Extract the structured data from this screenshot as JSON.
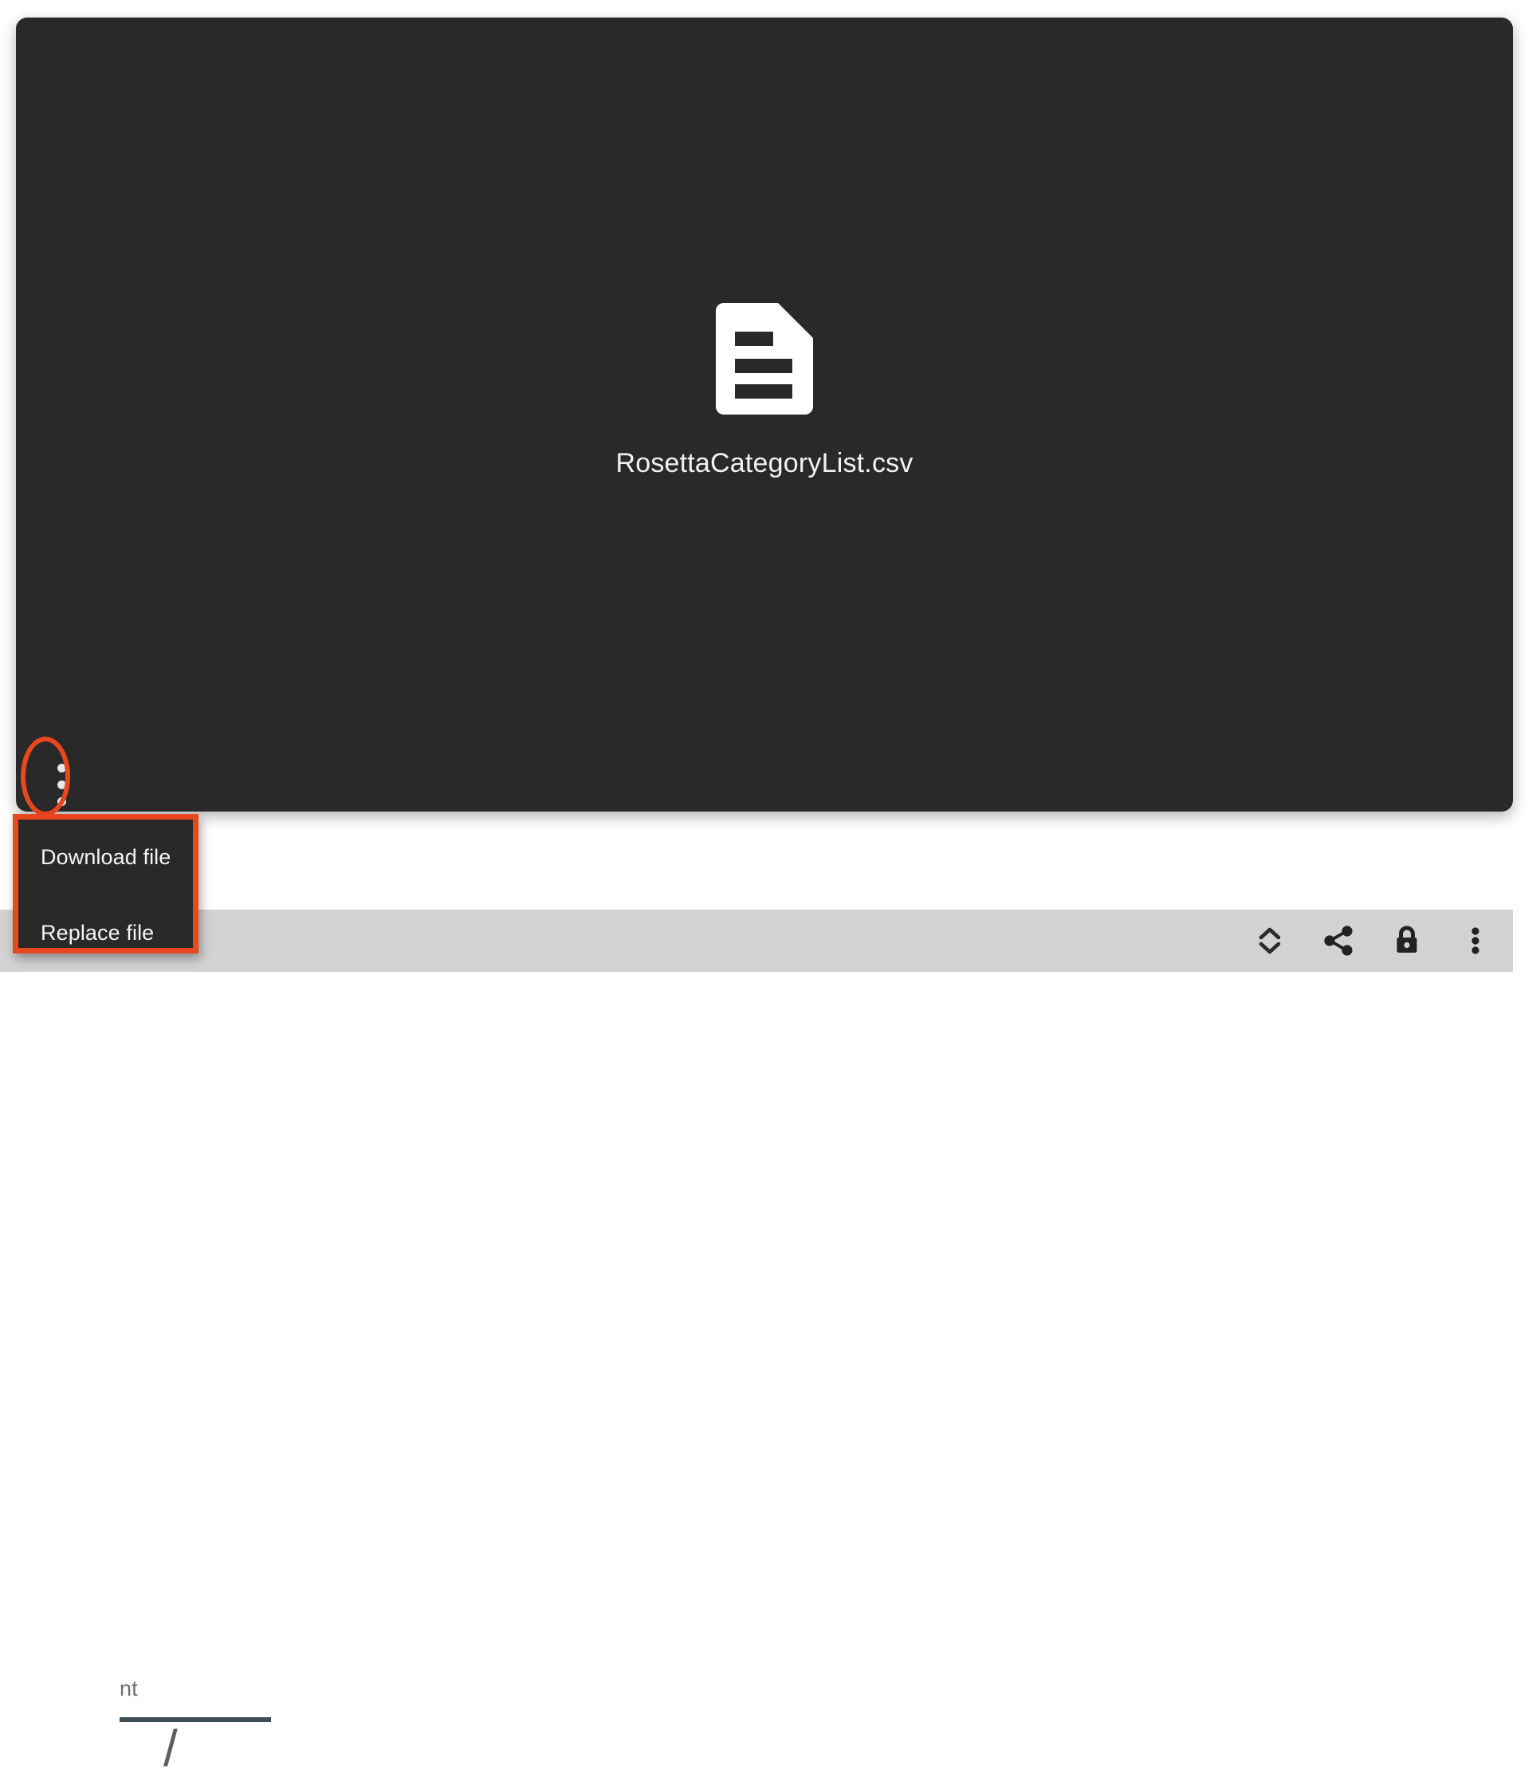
{
  "preview": {
    "file_name": "RosettaCategoryList.csv",
    "file_icon": "document-lines-icon",
    "background_color": "#292929",
    "overflow_button_icon": "kebab-menu-icon"
  },
  "context_menu": {
    "items": [
      {
        "label": "Download file",
        "icon": "download-file-item"
      },
      {
        "label": "Replace file",
        "icon": "replace-file-item"
      }
    ],
    "highlight_color": "#e8471f"
  },
  "annotations": {
    "ellipse_target": "overflow-menu-button",
    "rectangle_target": "context-menu",
    "color": "#e8471f"
  },
  "underlying_form": {
    "partial_label": "nt",
    "field_divider_color": "#3f4f5a",
    "separator_glyph": "/"
  },
  "bottom_toolbar": {
    "background_color": "#d2d2d2",
    "actions": [
      {
        "name": "expand-collapse-icon",
        "label": "Expand"
      },
      {
        "name": "share-icon",
        "label": "Share"
      },
      {
        "name": "lock-icon",
        "label": "Lock"
      },
      {
        "name": "more-options-icon",
        "label": "More options"
      }
    ]
  }
}
